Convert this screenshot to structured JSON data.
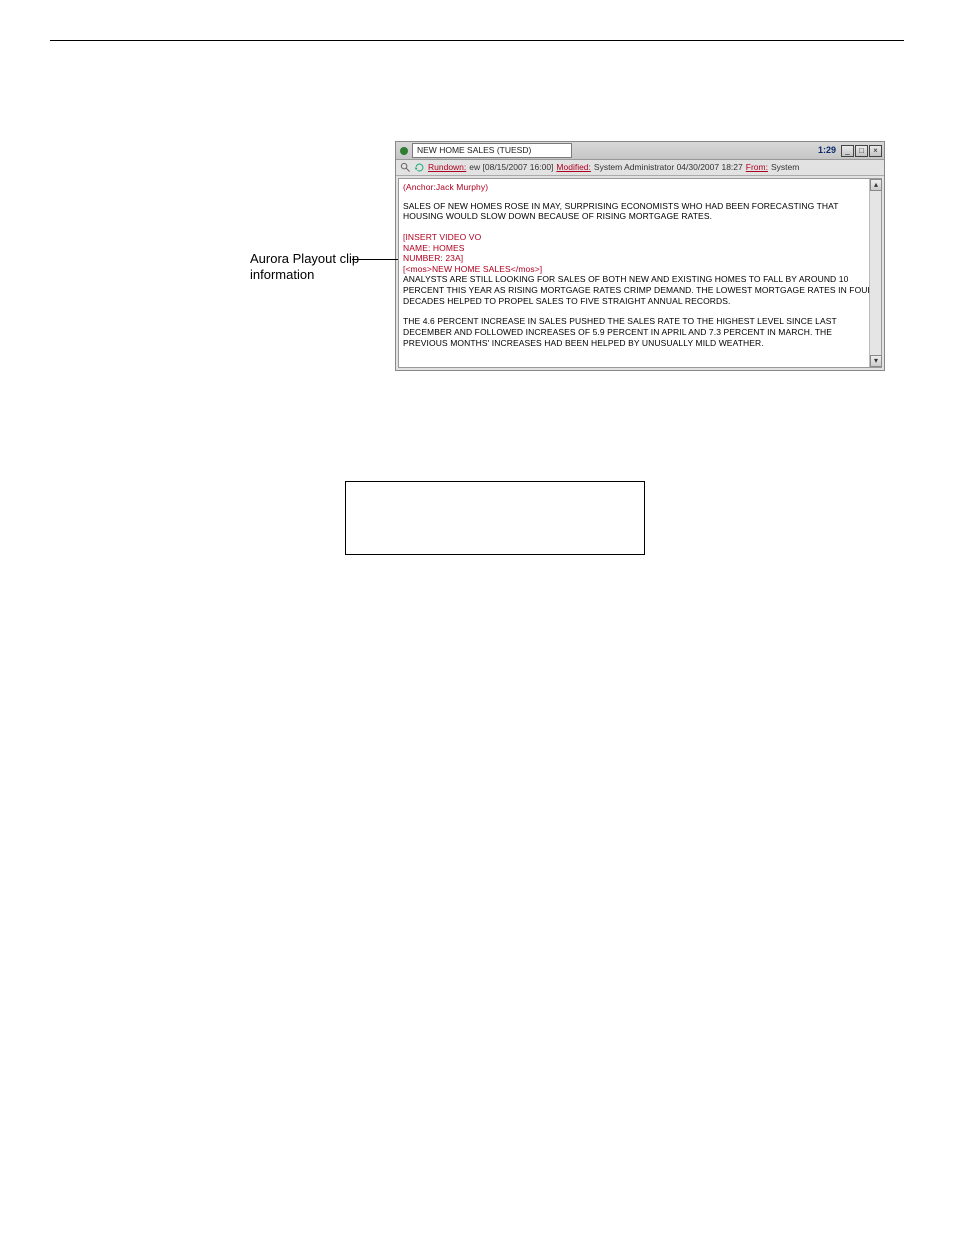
{
  "callout": {
    "text": "Aurora Playout clip information"
  },
  "window": {
    "title": "NEW HOME SALES (TUESD)",
    "duration": "1:29",
    "controls": {
      "min": "_",
      "max": "□",
      "close": "×"
    },
    "meta": {
      "rundown_key": "Rundown:",
      "rundown_val": "ew [08/15/2007 16:00]",
      "modified_key": "Modified:",
      "modified_val": "System Administrator  04/30/2007 18:27",
      "from_key": "From:",
      "from_val": "System"
    },
    "script": {
      "anchor": "(Anchor:Jack Murphy)",
      "p1": "SALES OF NEW HOMES ROSE IN MAY, SURPRISING ECONOMISTS WHO HAD BEEN FORECASTING THAT HOUSING WOULD SLOW DOWN BECAUSE OF RISING MORTGAGE RATES.",
      "cmd1": "[INSERT VIDEO VO",
      "cmd2": "NAME: HOMES",
      "cmd3": "NUMBER: 23A]",
      "cmd4": "[<mos>NEW HOME SALES</mos>]",
      "p2": "ANALYSTS ARE STILL LOOKING FOR SALES OF BOTH NEW AND EXISTING HOMES TO FALL BY AROUND 10 PERCENT THIS YEAR AS RISING MORTGAGE RATES CRIMP DEMAND. THE LOWEST MORTGAGE RATES IN FOUR DECADES HELPED TO PROPEL SALES TO FIVE STRAIGHT ANNUAL RECORDS.",
      "p3": "THE 4.6 PERCENT INCREASE IN SALES PUSHED THE SALES RATE TO THE HIGHEST LEVEL SINCE LAST DECEMBER AND FOLLOWED INCREASES OF 5.9 PERCENT IN APRIL AND 7.3 PERCENT IN MARCH. THE PREVIOUS MONTHS' INCREASES HAD BEEN HELPED BY UNUSUALLY MILD WEATHER."
    }
  }
}
